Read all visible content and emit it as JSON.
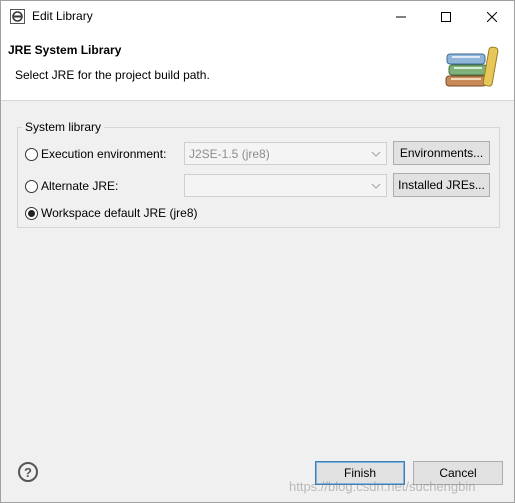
{
  "window": {
    "title": "Edit Library",
    "buttons": {
      "minimize_icon": "minimize-icon",
      "maximize_icon": "maximize-icon",
      "close_icon": "close-icon"
    }
  },
  "header": {
    "title": "JRE System Library",
    "description": "Select JRE for the project build path.",
    "icon": "library-books-icon"
  },
  "system_library": {
    "group_label": "System library",
    "options": [
      {
        "label": "Execution environment:",
        "selected": false,
        "combo_value": "J2SE-1.5 (jre8)",
        "combo_enabled": false,
        "button": "Environments..."
      },
      {
        "label": "Alternate JRE:",
        "selected": false,
        "combo_value": "",
        "combo_enabled": false,
        "button": "Installed JREs..."
      },
      {
        "label": "Workspace default JRE (jre8)",
        "selected": true
      }
    ]
  },
  "footer": {
    "help_icon": "help-icon",
    "help_glyph": "?",
    "finish_label": "Finish",
    "cancel_label": "Cancel"
  },
  "watermark": "https://blog.csdn.net/suchengbin"
}
